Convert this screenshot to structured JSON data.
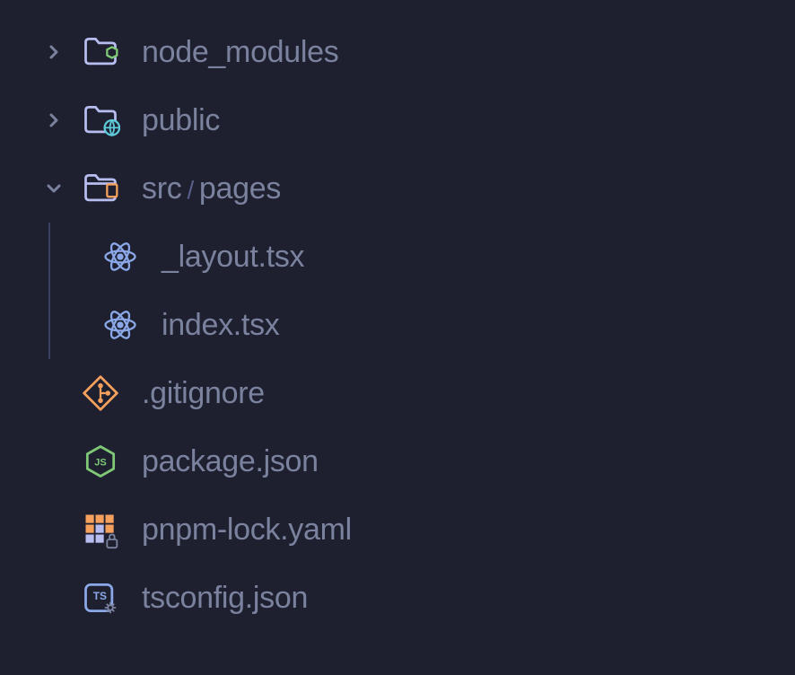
{
  "tree": {
    "node_modules": "node_modules",
    "public": "public",
    "src": "src",
    "pages": "pages",
    "layout_file": "_layout.tsx",
    "index_file": "index.tsx",
    "gitignore": ".gitignore",
    "package_json": "package.json",
    "pnpm_lock": "pnpm-lock.yaml",
    "tsconfig": "tsconfig.json"
  }
}
